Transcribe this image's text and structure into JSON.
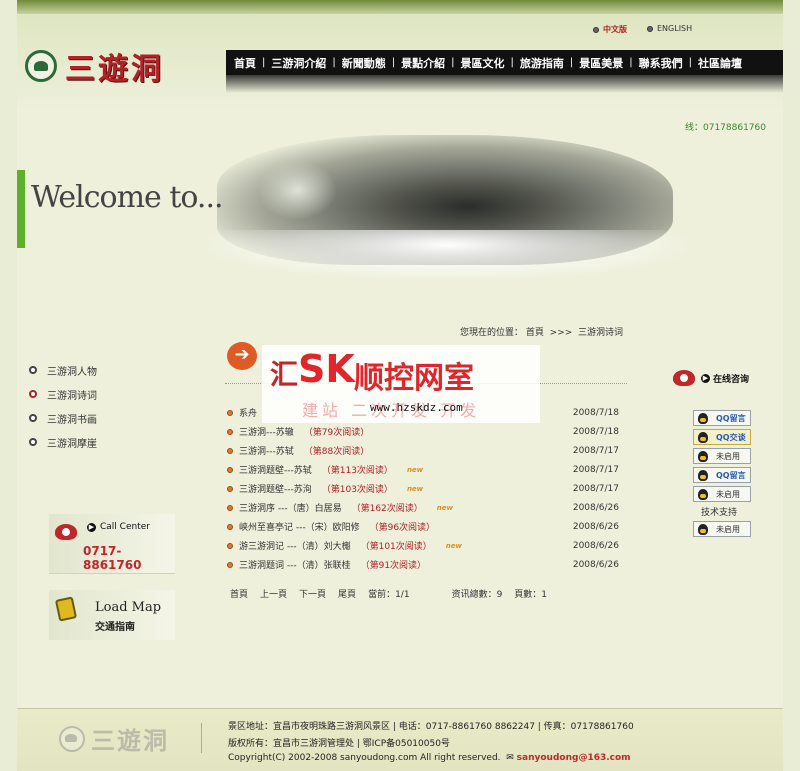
{
  "header": {
    "lang_cn": "中文版",
    "lang_en": "ENGLISH",
    "logo_text": "三遊洞",
    "hotline": "线：07178861760"
  },
  "nav": [
    "首頁",
    "三游洞介紹",
    "新聞動態",
    "景點介紹",
    "景區文化",
    "旅游指南",
    "景區美景",
    "聯系我們",
    "社區論壇"
  ],
  "banner": {
    "welcome": "Welcome to..."
  },
  "breadcrumb": {
    "prefix": "您現在的位置：",
    "home": "首頁",
    "sep": ">>>",
    "current": "三游洞诗词"
  },
  "sidebar": {
    "items": [
      "三游洞人物",
      "三游洞诗词",
      "三游洞书画",
      "三游洞摩崖"
    ],
    "active_index": 1
  },
  "call_center": {
    "title": "Call Center",
    "phone": "0717-8861760"
  },
  "load_map": {
    "title": "Load Map",
    "subtitle": "交通指南"
  },
  "watermark": {
    "prefix": "汇",
    "brand": "SK",
    "main": "顺控网室",
    "sub": "建站 二次开发 开发",
    "url": "www.hzskdz.com"
  },
  "list": [
    {
      "title": "系舟",
      "views": "",
      "hot": false,
      "date": "2008/7/18"
    },
    {
      "title": "三游洞---苏辙",
      "views": "（第79次阅读）",
      "hot": false,
      "date": "2008/7/18"
    },
    {
      "title": "三游洞---苏轼",
      "views": "（第88次阅读）",
      "hot": false,
      "date": "2008/7/17"
    },
    {
      "title": "三游洞题壁---苏轼",
      "views": "（第113次阅读）",
      "hot": true,
      "date": "2008/7/17"
    },
    {
      "title": "三游洞题壁---苏洵",
      "views": "（第103次阅读）",
      "hot": true,
      "date": "2008/7/17"
    },
    {
      "title": "三游洞序 ---（唐）白居易",
      "views": "（第162次阅读）",
      "hot": true,
      "date": "2008/6/26"
    },
    {
      "title": "峡州至喜亭记 ---（宋）欧阳修",
      "views": "（第96次阅读）",
      "hot": false,
      "date": "2008/6/26"
    },
    {
      "title": "游三游洞记 ---（清）刘大櫆",
      "views": "（第101次阅读）",
      "hot": true,
      "date": "2008/6/26"
    },
    {
      "title": "三游洞题词 ---（清）张联桂",
      "views": "（第91次阅读）",
      "hot": false,
      "date": "2008/6/26"
    }
  ],
  "hot_label": "new",
  "pager": {
    "first": "首頁",
    "prev": "上一頁",
    "next": "下一頁",
    "last": "尾頁",
    "current": "當前：1/1",
    "total": "资讯總數：9",
    "pages": "頁數：1"
  },
  "consult": {
    "title": "在线咨询",
    "buttons": [
      "QQ留言",
      "QQ交谈",
      "未启用",
      "QQ留言",
      "未启用"
    ],
    "tech_support": "技术支持",
    "tech_button": "未启用"
  },
  "footer": {
    "logo_text": "三遊洞",
    "line1": "景区地址：宜昌市夜明珠路三游洞风景区   | 电话：0717-8861760 8862247  | 传真：07178861760",
    "line2": "版权所有：宜昌市三游洞管理处            | 鄂ICP备05010050号",
    "line3": "Copyright(C) 2002-2008 sanyoudong.com All right reserved.",
    "email": "sanyoudong@163.com"
  }
}
